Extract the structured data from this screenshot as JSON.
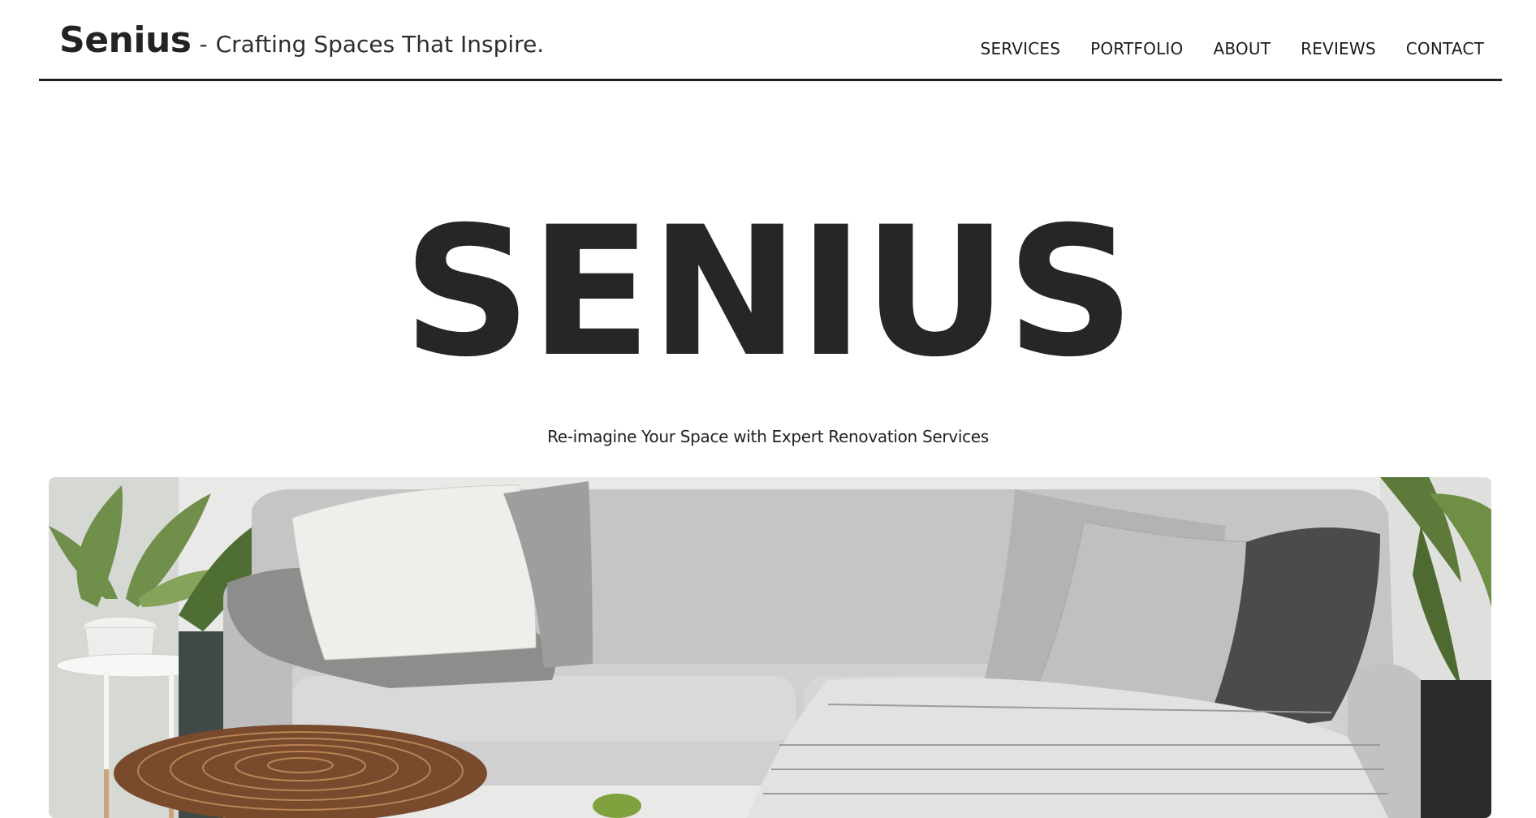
{
  "brand": {
    "name": "Senius",
    "separator": "-",
    "tagline": "Crafting Spaces That Inspire."
  },
  "nav": {
    "items": [
      {
        "label": "SERVICES"
      },
      {
        "label": "PORTFOLIO"
      },
      {
        "label": "ABOUT"
      },
      {
        "label": "REVIEWS"
      },
      {
        "label": "CONTACT"
      }
    ]
  },
  "hero": {
    "title": "SENIUS",
    "subtitle": "Re-imagine Your Space with Expert Renovation Services"
  },
  "colors": {
    "text": "#262626",
    "background": "#ffffff",
    "divider": "#1f1f1f"
  }
}
